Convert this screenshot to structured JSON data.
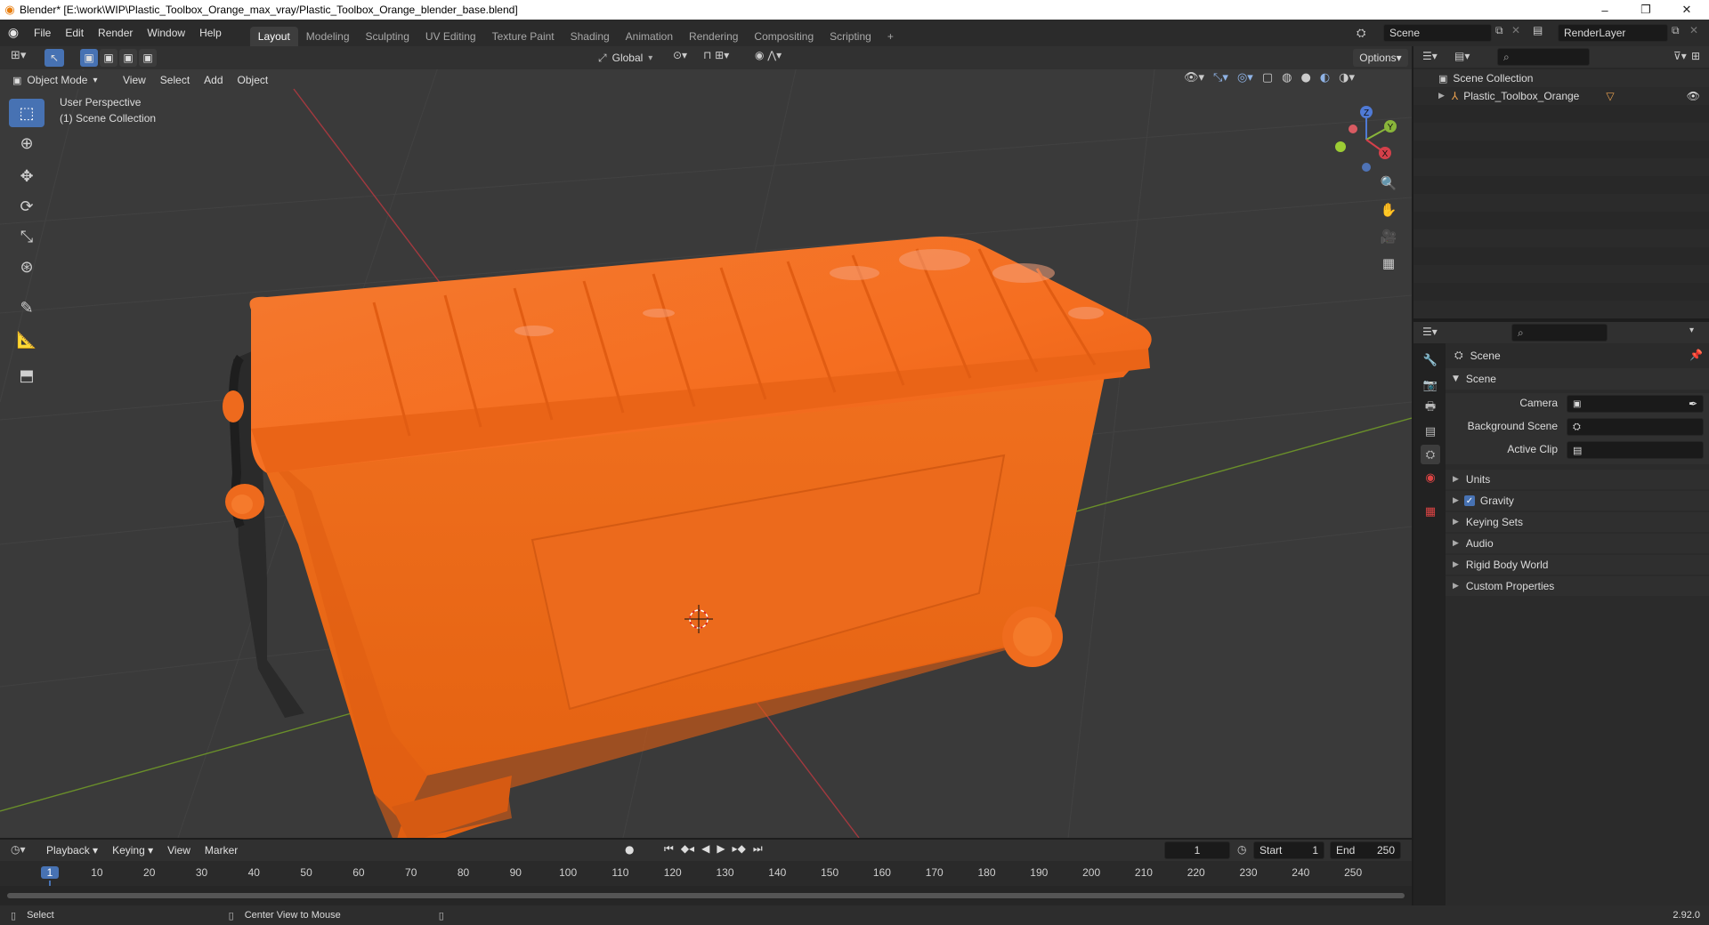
{
  "window": {
    "title": "Blender* [E:\\work\\WIP\\Plastic_Toolbox_Orange_max_vray/Plastic_Toolbox_Orange_blender_base.blend]",
    "controls": [
      "–",
      "❐",
      "✕"
    ]
  },
  "menu": [
    "File",
    "Edit",
    "Render",
    "Window",
    "Help"
  ],
  "workspaces": [
    "Layout",
    "Modeling",
    "Sculpting",
    "UV Editing",
    "Texture Paint",
    "Shading",
    "Animation",
    "Rendering",
    "Compositing",
    "Scripting"
  ],
  "active_workspace": "Layout",
  "scene_field": "Scene",
  "render_layer_field": "RenderLayer",
  "viewport_header": {
    "transform_orientation": "Global",
    "options_label": "Options",
    "mode": "Object Mode",
    "menus": [
      "View",
      "Select",
      "Add",
      "Object"
    ]
  },
  "viewport": {
    "perspective_label": "User Perspective",
    "collection_label": "(1) Scene Collection",
    "gizmo_axes": [
      "Z",
      "Y",
      "X"
    ]
  },
  "toolbar_tools": [
    "select-box",
    "cursor",
    "move",
    "rotate",
    "scale",
    "transform",
    "annotate",
    "measure",
    "add-cube"
  ],
  "outliner": {
    "root": "Scene Collection",
    "items": [
      {
        "label": "Plastic_Toolbox_Orange"
      }
    ]
  },
  "properties": {
    "context_title": "Scene",
    "panel_title": "Scene",
    "fields": [
      {
        "label": "Camera",
        "value": ""
      },
      {
        "label": "Background Scene",
        "value": ""
      },
      {
        "label": "Active Clip",
        "value": ""
      }
    ],
    "subpanels": [
      "Units",
      "Gravity",
      "Keying Sets",
      "Audio",
      "Rigid Body World",
      "Custom Properties"
    ],
    "gravity_checked": true
  },
  "timeline": {
    "menus": [
      "Playback",
      "Keying",
      "View",
      "Marker"
    ],
    "current_frame": "1",
    "start_label": "Start",
    "start_value": "1",
    "end_label": "End",
    "end_value": "250",
    "ticks": [
      "1",
      "10",
      "20",
      "30",
      "40",
      "50",
      "60",
      "70",
      "80",
      "90",
      "100",
      "110",
      "120",
      "130",
      "140",
      "150",
      "160",
      "170",
      "180",
      "190",
      "200",
      "210",
      "220",
      "230",
      "240",
      "250"
    ]
  },
  "status": {
    "left_action": "Select",
    "middle_action": "Center View to Mouse",
    "version": "2.92.0"
  },
  "colors": {
    "accent": "#4772b3",
    "object_orange": "#f36a1c",
    "viewport_bg": "#3a3a3a"
  }
}
